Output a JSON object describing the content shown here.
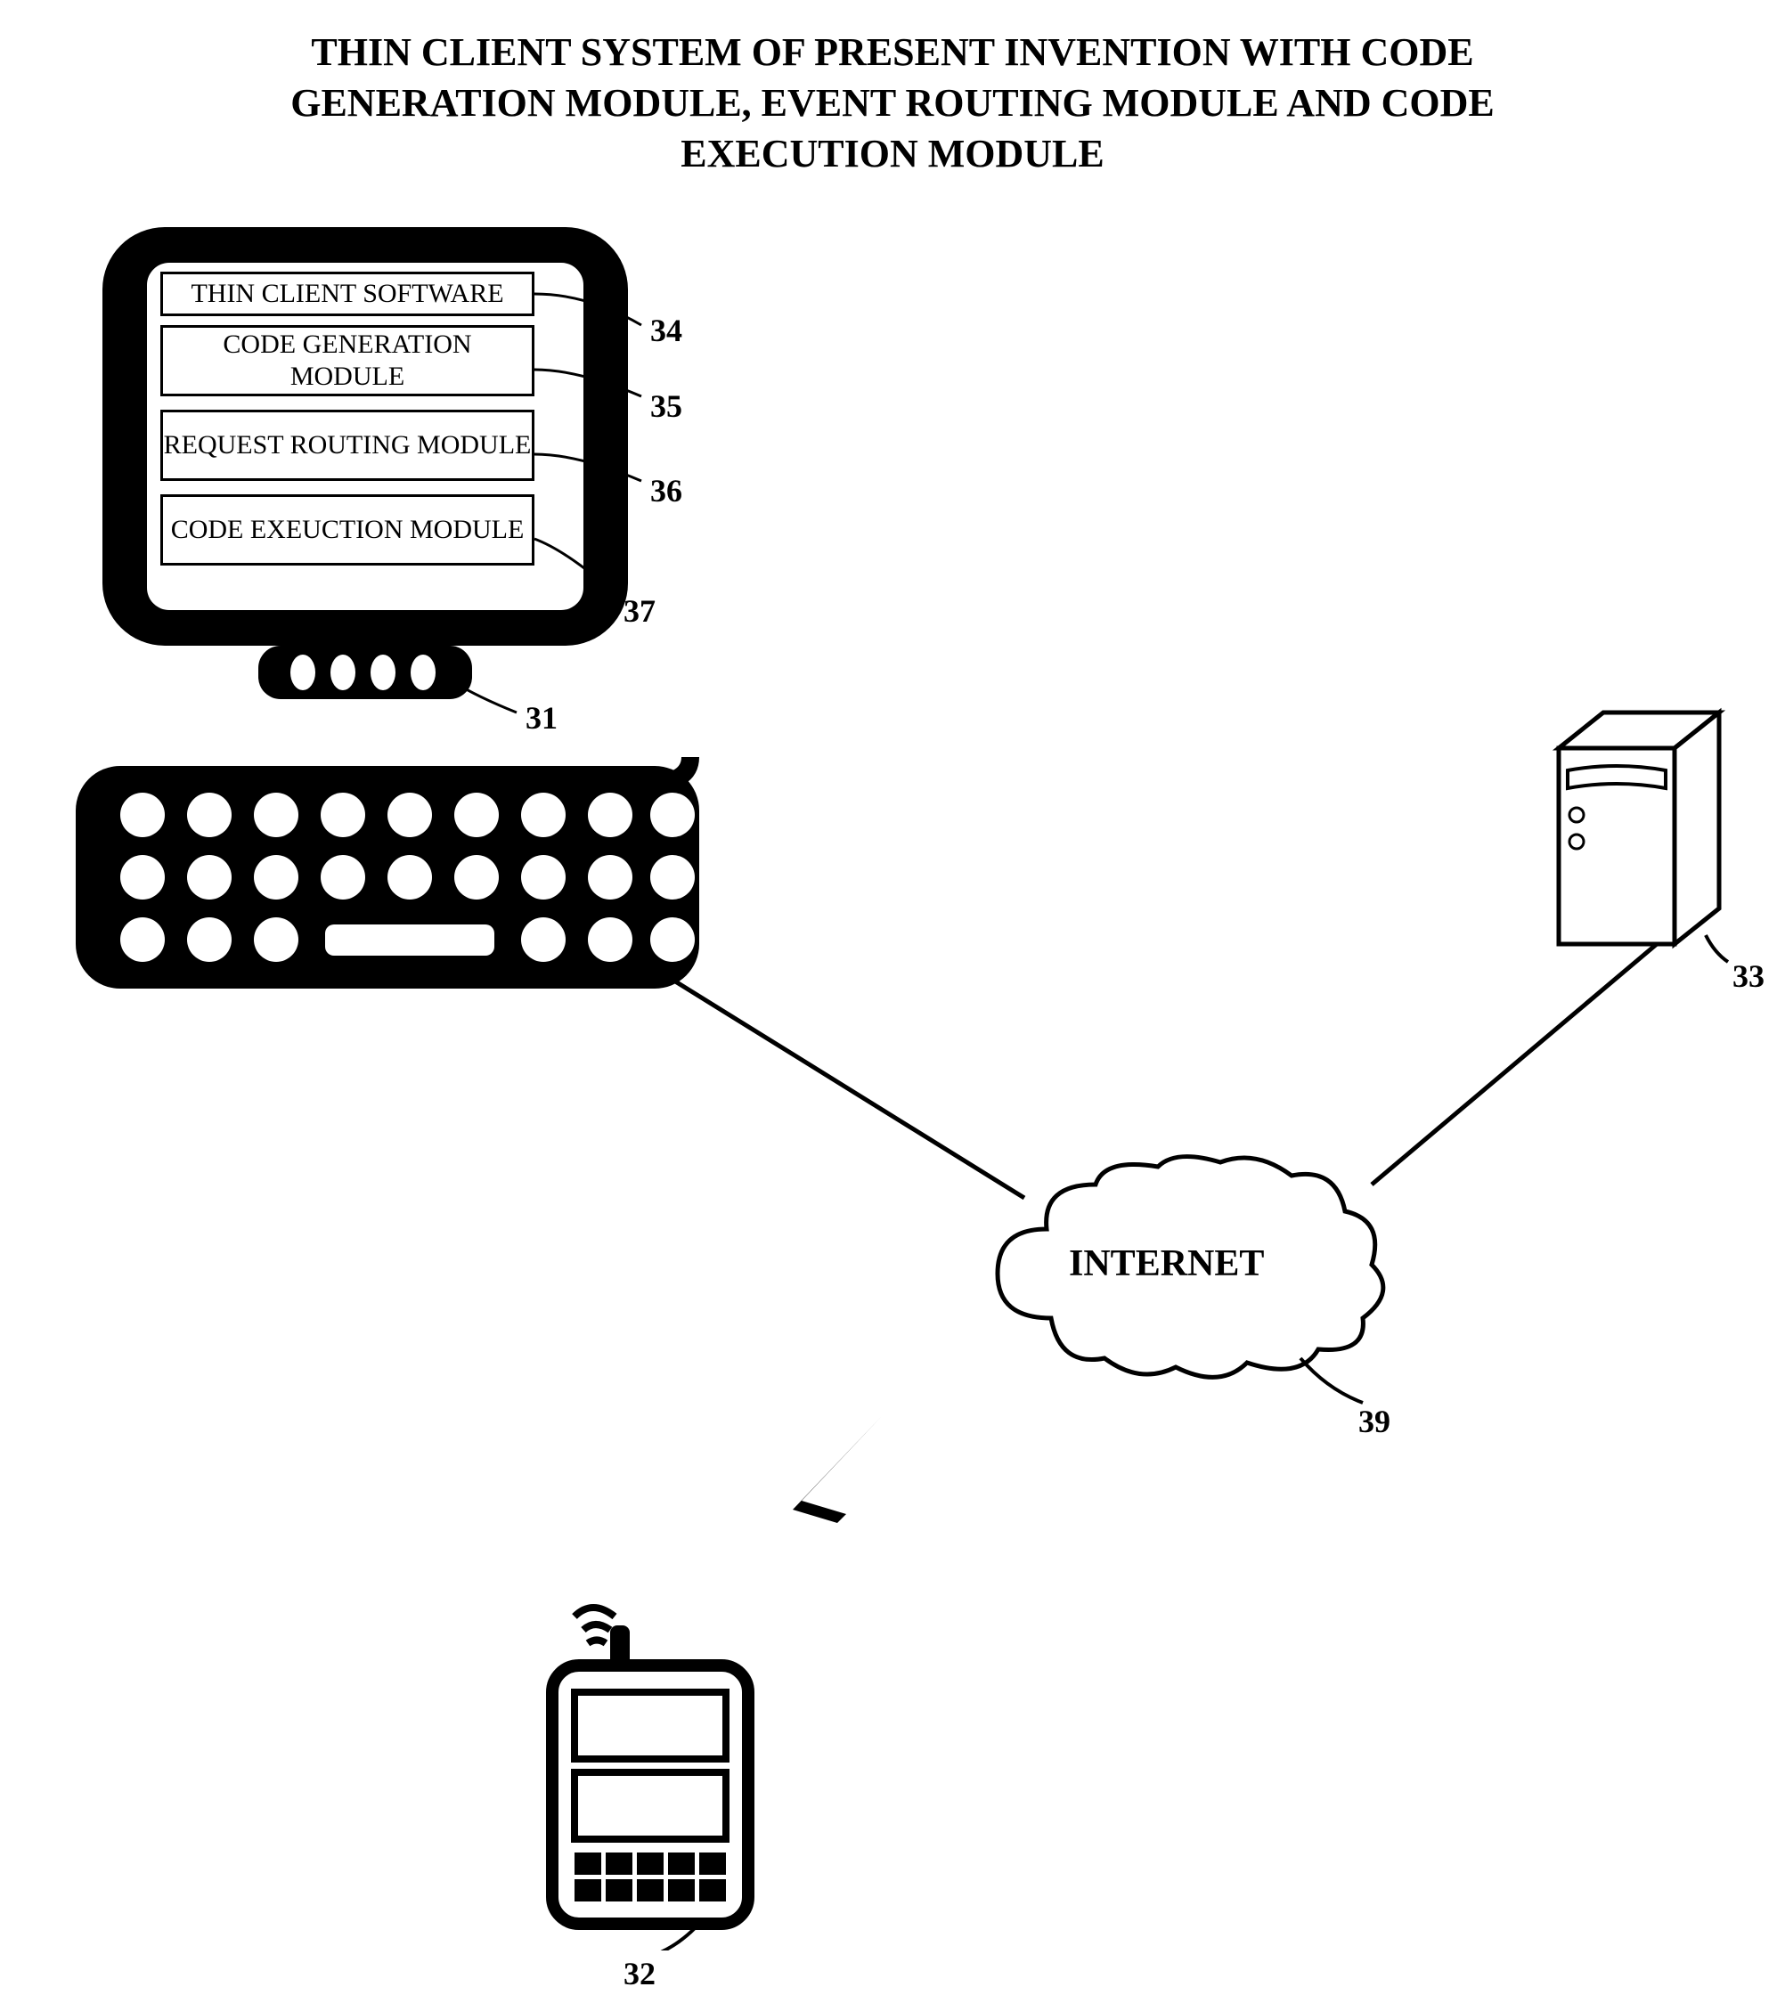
{
  "title": "THIN CLIENT SYSTEM OF PRESENT INVENTION WITH CODE GENERATION MODULE, EVENT ROUTING MODULE AND CODE EXECUTION MODULE",
  "modules": {
    "thin_client": "THIN CLIENT SOFTWARE",
    "code_gen": "CODE GENERATION MODULE",
    "request_routing": "REQUEST ROUTING MODULE",
    "code_exec": "CODE EXEUCTION MODULE"
  },
  "cloud_label": "INTERNET",
  "reference_numerals": {
    "monitor_stand": "31",
    "mobile_device": "32",
    "server": "33",
    "thin_client_sw": "34",
    "code_gen_module": "35",
    "request_routing_module": "36",
    "code_exec_module": "37",
    "cloud": "39"
  }
}
